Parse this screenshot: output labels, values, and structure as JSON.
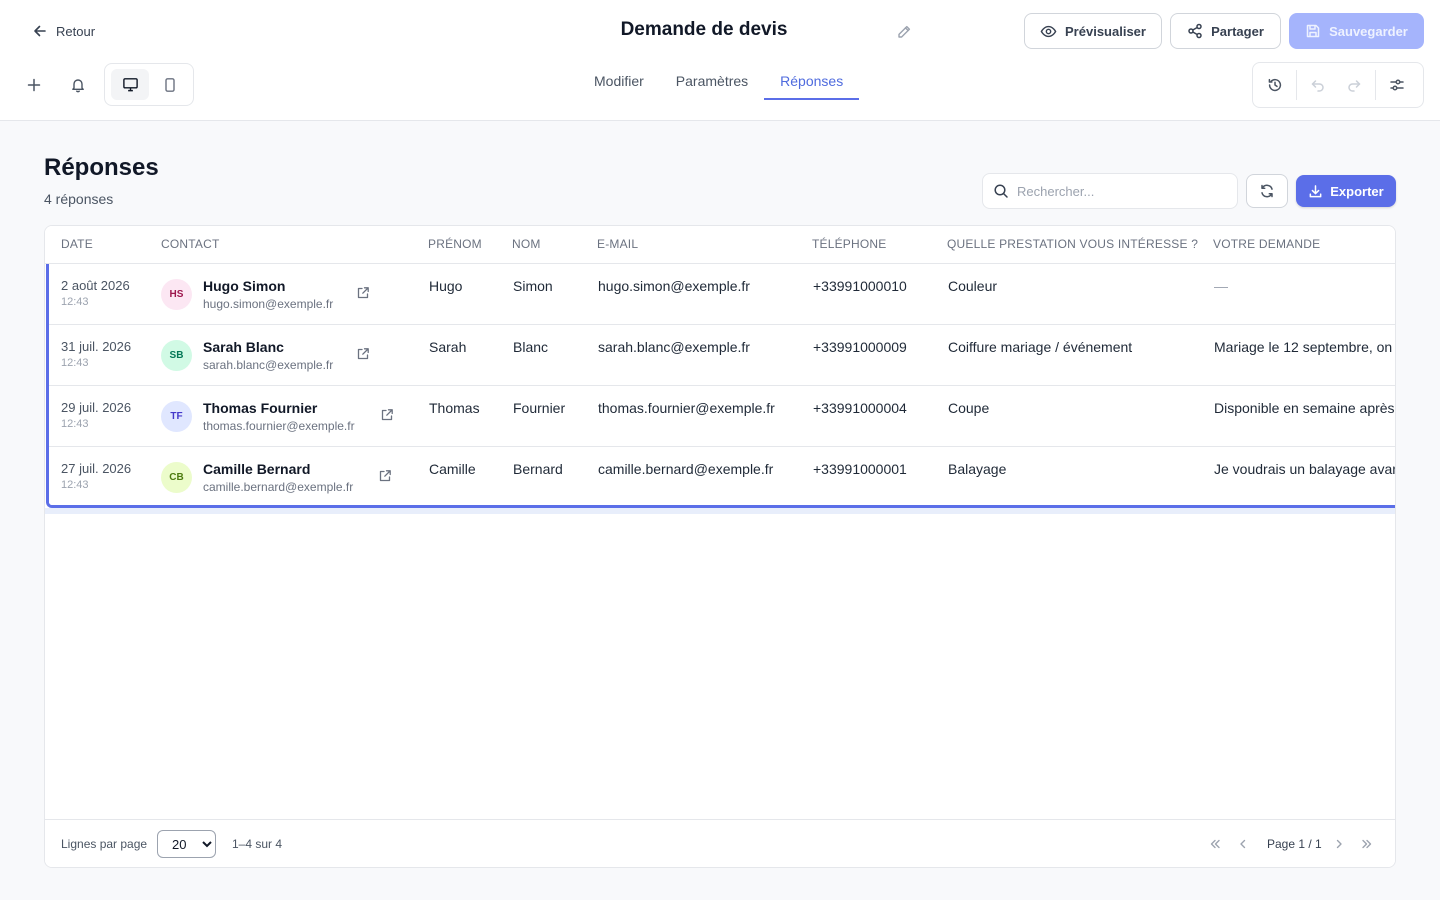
{
  "header": {
    "back_label": "Retour",
    "title": "Demande de devis",
    "preview_label": "Prévisualiser",
    "share_label": "Partager",
    "save_label": "Sauvegarder"
  },
  "tabs": [
    {
      "label": "Modifier",
      "active": false
    },
    {
      "label": "Paramètres",
      "active": false
    },
    {
      "label": "Réponses",
      "active": true
    }
  ],
  "page": {
    "heading": "Réponses",
    "count": "4 réponses"
  },
  "search": {
    "placeholder": "Rechercher..."
  },
  "export_label": "Exporter",
  "table": {
    "columns": [
      "DATE",
      "CONTACT",
      "PRÉNOM",
      "NOM",
      "E-MAIL",
      "TÉLÉPHONE",
      "QUELLE PRESTATION VOUS INTÉRESSE ?",
      "VOTRE DEMANDE"
    ],
    "rows": [
      {
        "date": "2 août 2026",
        "time": "12:43",
        "initials": "HS",
        "avatar_bg": "#fce7f3",
        "avatar_fg": "#9d174d",
        "name": "Hugo Simon",
        "email": "hugo.simon@exemple.fr",
        "prenom": "Hugo",
        "nom": "Simon",
        "email_col": "hugo.simon@exemple.fr",
        "phone": "+33991000010",
        "prestation": "Couleur",
        "demande": "—"
      },
      {
        "date": "31 juil. 2026",
        "time": "12:43",
        "initials": "SB",
        "avatar_bg": "#d1fae5",
        "avatar_fg": "#047857",
        "name": "Sarah Blanc",
        "email": "sarah.blanc@exemple.fr",
        "prenom": "Sarah",
        "nom": "Blanc",
        "email_col": "sarah.blanc@exemple.fr",
        "phone": "+33991000009",
        "prestation": "Coiffure mariage / événement",
        "demande": "Mariage le 12 septembre, on"
      },
      {
        "date": "29 juil. 2026",
        "time": "12:43",
        "initials": "TF",
        "avatar_bg": "#e0e7ff",
        "avatar_fg": "#4338ca",
        "name": "Thomas Fournier",
        "email": "thomas.fournier@exemple.fr",
        "prenom": "Thomas",
        "nom": "Fournier",
        "email_col": "thomas.fournier@exemple.fr",
        "phone": "+33991000004",
        "prestation": "Coupe",
        "demande": "Disponible en semaine après"
      },
      {
        "date": "27 juil. 2026",
        "time": "12:43",
        "initials": "CB",
        "avatar_bg": "#ecfccb",
        "avatar_fg": "#4d7c0f",
        "name": "Camille Bernard",
        "email": "camille.bernard@exemple.fr",
        "prenom": "Camille",
        "nom": "Bernard",
        "email_col": "camille.bernard@exemple.fr",
        "phone": "+33991000001",
        "prestation": "Balayage",
        "demande": "Je voudrais un balayage avan"
      }
    ]
  },
  "footer": {
    "rows_per_page_label": "Lignes par page",
    "page_size": "20",
    "page_size_options": [
      "20"
    ],
    "range": "1–4 sur 4",
    "page_label": "Page 1 / 1"
  },
  "colors": {
    "accent": "#5b6ee8",
    "save_disabled": "#a5b4fc"
  },
  "icons": {
    "back": "arrow-left-icon",
    "edit": "pencil-icon",
    "preview": "eye-icon",
    "share": "share-icon",
    "save": "save-icon",
    "add": "plus-icon",
    "notifications": "bell-icon",
    "desktop": "monitor-icon",
    "mobile": "smartphone-icon",
    "history": "history-icon",
    "undo": "undo-icon",
    "redo": "redo-icon",
    "settings": "sliders-icon",
    "search": "search-icon",
    "refresh": "refresh-icon",
    "export": "download-icon",
    "open_contact": "external-link-icon"
  }
}
